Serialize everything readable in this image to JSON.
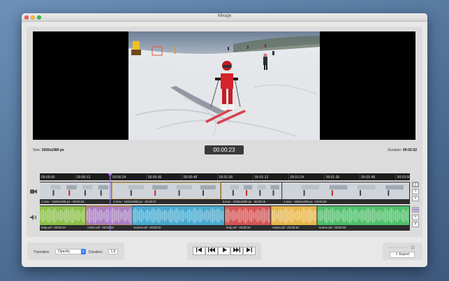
{
  "window": {
    "title": "Mixage"
  },
  "preview": {
    "size_label": "Size:",
    "size_value": "1920x1080 px",
    "timecode": "00:00:23",
    "duration_label": "Duration:",
    "duration_value": "00:02:52"
  },
  "timeline": {
    "ruler": [
      "00:00:00",
      "00:00:12",
      "00:00:24",
      "00:00:36",
      "00:00:48",
      "00:01:00",
      "00:01:12",
      "00:01:24",
      "00:01:36",
      "00:01:48",
      "00:02:00"
    ],
    "playhead_fraction": 0.19,
    "video_clips": [
      {
        "label": "1.mov - 1920x1080 px - 00:00:25",
        "start": 0.0,
        "end": 0.195
      },
      {
        "label": "2.mov - 1920x1080 px - 00:00:37",
        "start": 0.195,
        "end": 0.49
      },
      {
        "label": "3.mov - 1920x1080 px - 00:00:16",
        "start": 0.49,
        "end": 0.655
      },
      {
        "label": "4.mov - 1920x1080 px - 00:00:28",
        "start": 0.655,
        "end": 1.0
      }
    ],
    "audio_clips": [
      {
        "label": "help.caf - 00:00:16",
        "start": 0.0,
        "end": 0.125,
        "color": "#8cc04a"
      },
      {
        "label": "metro.caf - 00:00:16",
        "start": 0.125,
        "end": 0.25,
        "color": "#a87ec0"
      },
      {
        "label": "scores.caf - 00:00:32",
        "start": 0.25,
        "end": 0.5,
        "color": "#47a9cf"
      },
      {
        "label": "help.caf - 00:00:16",
        "start": 0.5,
        "end": 0.625,
        "color": "#d35555"
      },
      {
        "label": "metro.caf - 00:00:16",
        "start": 0.625,
        "end": 0.75,
        "color": "#e6b64c"
      },
      {
        "label": "scores.caf - 00:00:32",
        "start": 0.75,
        "end": 1.0,
        "color": "#4fbf6a"
      }
    ],
    "icons": {
      "video_track": "video-camera-icon",
      "audio_track": "speaker-icon"
    },
    "buttons": {
      "add": "+",
      "remove": "×"
    }
  },
  "controls": {
    "transition_label": "Transition:",
    "transition_value": "Opacity",
    "duration_label": "Duration:",
    "duration_value": "1,5"
  },
  "transport": {
    "first": "⏮",
    "prev": "⏪",
    "play": "▶",
    "next": "⏩",
    "last": "⏭"
  },
  "export": {
    "label": "Export"
  },
  "colors": {
    "audio_selected_border": "#d49a2a",
    "playhead": "#a66ef0"
  }
}
